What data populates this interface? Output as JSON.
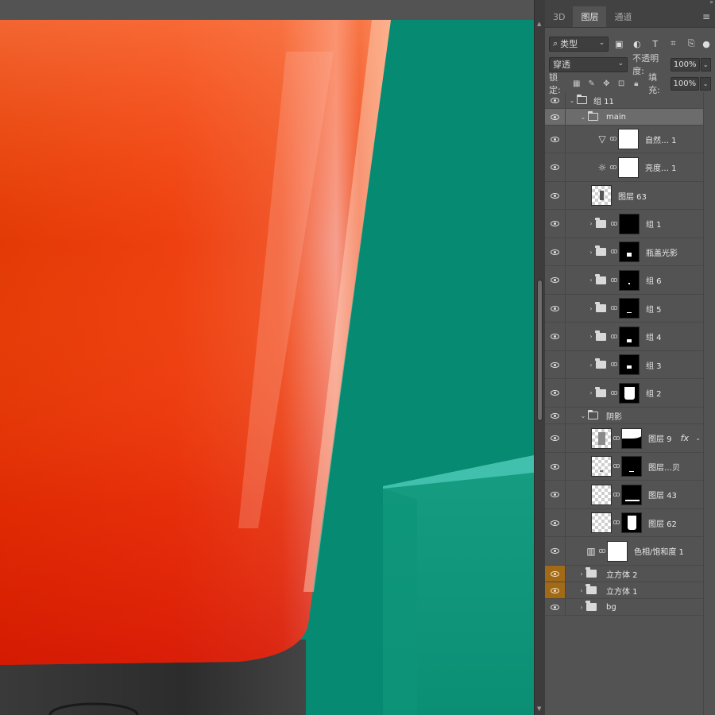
{
  "panel": {
    "tabs": [
      {
        "label": "3D"
      },
      {
        "label": "图层"
      },
      {
        "label": "通道"
      }
    ],
    "filter_label": "类型",
    "blend_mode": "穿透",
    "opacity_label": "不透明度:",
    "opacity_value": "100%",
    "lock_label": "锁定:",
    "fill_label": "填充:",
    "fill_value": "100%"
  },
  "layers": [
    {
      "name": "组 11",
      "type": "group",
      "expanded": true
    },
    {
      "name": "main",
      "type": "group",
      "expanded": true,
      "selected": true
    },
    {
      "name": "自然… 1",
      "type": "adjustment",
      "icon": "vibrance-triangle-icon"
    },
    {
      "name": "亮度… 1",
      "type": "adjustment",
      "icon": "brightness-sun-icon"
    },
    {
      "name": "图层 63",
      "type": "pixel"
    },
    {
      "name": "组 1",
      "type": "group",
      "masked": true
    },
    {
      "name": "瓶盖光影",
      "type": "group",
      "masked": true
    },
    {
      "name": "组 6",
      "type": "group",
      "masked": true
    },
    {
      "name": "组 5",
      "type": "group",
      "masked": true
    },
    {
      "name": "组 4",
      "type": "group",
      "masked": true
    },
    {
      "name": "组 3",
      "type": "group",
      "masked": true
    },
    {
      "name": "组 2",
      "type": "group",
      "masked": true
    },
    {
      "name": "阴影",
      "type": "group",
      "expanded": true
    },
    {
      "name": "图层 9",
      "type": "pixel",
      "effect": "fx"
    },
    {
      "name": "图层…贝",
      "type": "pixel"
    },
    {
      "name": "图层 43",
      "type": "pixel"
    },
    {
      "name": "图层 62",
      "type": "pixel"
    },
    {
      "name": "色相/饱和度 1",
      "type": "adjustment",
      "icon": "hue-saturation-icon"
    },
    {
      "name": "立方体 2",
      "type": "group",
      "eye_color": "orange"
    },
    {
      "name": "立方体 1",
      "type": "group",
      "eye_color": "orange"
    },
    {
      "name": "bg",
      "type": "group"
    }
  ],
  "colors": {
    "canvas_bg": "#078a72",
    "bottle_orange": "#ef3a0e",
    "cube_top": "#41c1ad",
    "cube_front": "#0f9478",
    "cap": "#2c2c2c",
    "panel_bg": "#535353",
    "eye_highlight": "#a26a16"
  }
}
